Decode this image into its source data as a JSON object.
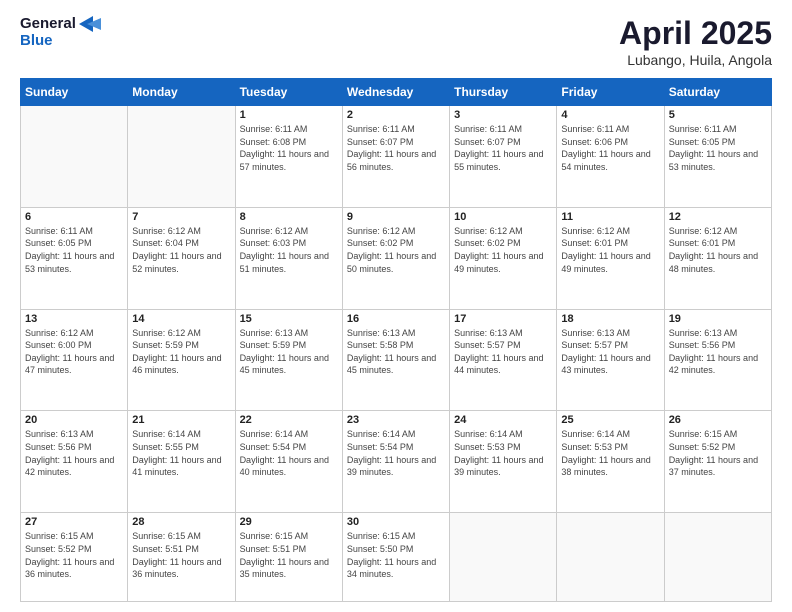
{
  "header": {
    "logo_general": "General",
    "logo_blue": "Blue",
    "title": "April 2025",
    "location": "Lubango, Huila, Angola"
  },
  "weekdays": [
    "Sunday",
    "Monday",
    "Tuesday",
    "Wednesday",
    "Thursday",
    "Friday",
    "Saturday"
  ],
  "weeks": [
    [
      {
        "day": "",
        "info": ""
      },
      {
        "day": "",
        "info": ""
      },
      {
        "day": "1",
        "info": "Sunrise: 6:11 AM\nSunset: 6:08 PM\nDaylight: 11 hours and 57 minutes."
      },
      {
        "day": "2",
        "info": "Sunrise: 6:11 AM\nSunset: 6:07 PM\nDaylight: 11 hours and 56 minutes."
      },
      {
        "day": "3",
        "info": "Sunrise: 6:11 AM\nSunset: 6:07 PM\nDaylight: 11 hours and 55 minutes."
      },
      {
        "day": "4",
        "info": "Sunrise: 6:11 AM\nSunset: 6:06 PM\nDaylight: 11 hours and 54 minutes."
      },
      {
        "day": "5",
        "info": "Sunrise: 6:11 AM\nSunset: 6:05 PM\nDaylight: 11 hours and 53 minutes."
      }
    ],
    [
      {
        "day": "6",
        "info": "Sunrise: 6:11 AM\nSunset: 6:05 PM\nDaylight: 11 hours and 53 minutes."
      },
      {
        "day": "7",
        "info": "Sunrise: 6:12 AM\nSunset: 6:04 PM\nDaylight: 11 hours and 52 minutes."
      },
      {
        "day": "8",
        "info": "Sunrise: 6:12 AM\nSunset: 6:03 PM\nDaylight: 11 hours and 51 minutes."
      },
      {
        "day": "9",
        "info": "Sunrise: 6:12 AM\nSunset: 6:02 PM\nDaylight: 11 hours and 50 minutes."
      },
      {
        "day": "10",
        "info": "Sunrise: 6:12 AM\nSunset: 6:02 PM\nDaylight: 11 hours and 49 minutes."
      },
      {
        "day": "11",
        "info": "Sunrise: 6:12 AM\nSunset: 6:01 PM\nDaylight: 11 hours and 49 minutes."
      },
      {
        "day": "12",
        "info": "Sunrise: 6:12 AM\nSunset: 6:01 PM\nDaylight: 11 hours and 48 minutes."
      }
    ],
    [
      {
        "day": "13",
        "info": "Sunrise: 6:12 AM\nSunset: 6:00 PM\nDaylight: 11 hours and 47 minutes."
      },
      {
        "day": "14",
        "info": "Sunrise: 6:12 AM\nSunset: 5:59 PM\nDaylight: 11 hours and 46 minutes."
      },
      {
        "day": "15",
        "info": "Sunrise: 6:13 AM\nSunset: 5:59 PM\nDaylight: 11 hours and 45 minutes."
      },
      {
        "day": "16",
        "info": "Sunrise: 6:13 AM\nSunset: 5:58 PM\nDaylight: 11 hours and 45 minutes."
      },
      {
        "day": "17",
        "info": "Sunrise: 6:13 AM\nSunset: 5:57 PM\nDaylight: 11 hours and 44 minutes."
      },
      {
        "day": "18",
        "info": "Sunrise: 6:13 AM\nSunset: 5:57 PM\nDaylight: 11 hours and 43 minutes."
      },
      {
        "day": "19",
        "info": "Sunrise: 6:13 AM\nSunset: 5:56 PM\nDaylight: 11 hours and 42 minutes."
      }
    ],
    [
      {
        "day": "20",
        "info": "Sunrise: 6:13 AM\nSunset: 5:56 PM\nDaylight: 11 hours and 42 minutes."
      },
      {
        "day": "21",
        "info": "Sunrise: 6:14 AM\nSunset: 5:55 PM\nDaylight: 11 hours and 41 minutes."
      },
      {
        "day": "22",
        "info": "Sunrise: 6:14 AM\nSunset: 5:54 PM\nDaylight: 11 hours and 40 minutes."
      },
      {
        "day": "23",
        "info": "Sunrise: 6:14 AM\nSunset: 5:54 PM\nDaylight: 11 hours and 39 minutes."
      },
      {
        "day": "24",
        "info": "Sunrise: 6:14 AM\nSunset: 5:53 PM\nDaylight: 11 hours and 39 minutes."
      },
      {
        "day": "25",
        "info": "Sunrise: 6:14 AM\nSunset: 5:53 PM\nDaylight: 11 hours and 38 minutes."
      },
      {
        "day": "26",
        "info": "Sunrise: 6:15 AM\nSunset: 5:52 PM\nDaylight: 11 hours and 37 minutes."
      }
    ],
    [
      {
        "day": "27",
        "info": "Sunrise: 6:15 AM\nSunset: 5:52 PM\nDaylight: 11 hours and 36 minutes."
      },
      {
        "day": "28",
        "info": "Sunrise: 6:15 AM\nSunset: 5:51 PM\nDaylight: 11 hours and 36 minutes."
      },
      {
        "day": "29",
        "info": "Sunrise: 6:15 AM\nSunset: 5:51 PM\nDaylight: 11 hours and 35 minutes."
      },
      {
        "day": "30",
        "info": "Sunrise: 6:15 AM\nSunset: 5:50 PM\nDaylight: 11 hours and 34 minutes."
      },
      {
        "day": "",
        "info": ""
      },
      {
        "day": "",
        "info": ""
      },
      {
        "day": "",
        "info": ""
      }
    ]
  ]
}
